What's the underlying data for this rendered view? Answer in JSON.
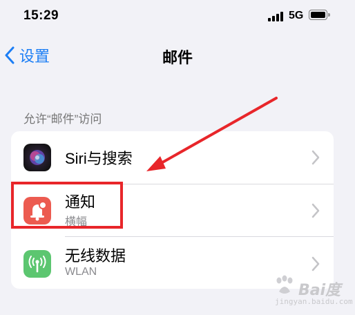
{
  "status_bar": {
    "time": "15:29",
    "network": "5G"
  },
  "nav": {
    "back_label": "设置",
    "title": "邮件"
  },
  "section": {
    "header": "允许“邮件”访问"
  },
  "rows": [
    {
      "title": "Siri与搜索",
      "icon": "siri-icon"
    },
    {
      "title": "通知",
      "subtitle": "横幅",
      "icon": "notifications-icon",
      "icon_color": "#ec5b50"
    },
    {
      "title": "无线数据",
      "subtitle": "WLAN",
      "icon": "antenna-icon",
      "icon_color": "#5cc670"
    }
  ],
  "colors": {
    "accent": "#1c7ef5",
    "annotation": "#e8262a"
  },
  "watermark": {
    "text": "Bai度",
    "sub": "jingyan.baidu.com"
  }
}
